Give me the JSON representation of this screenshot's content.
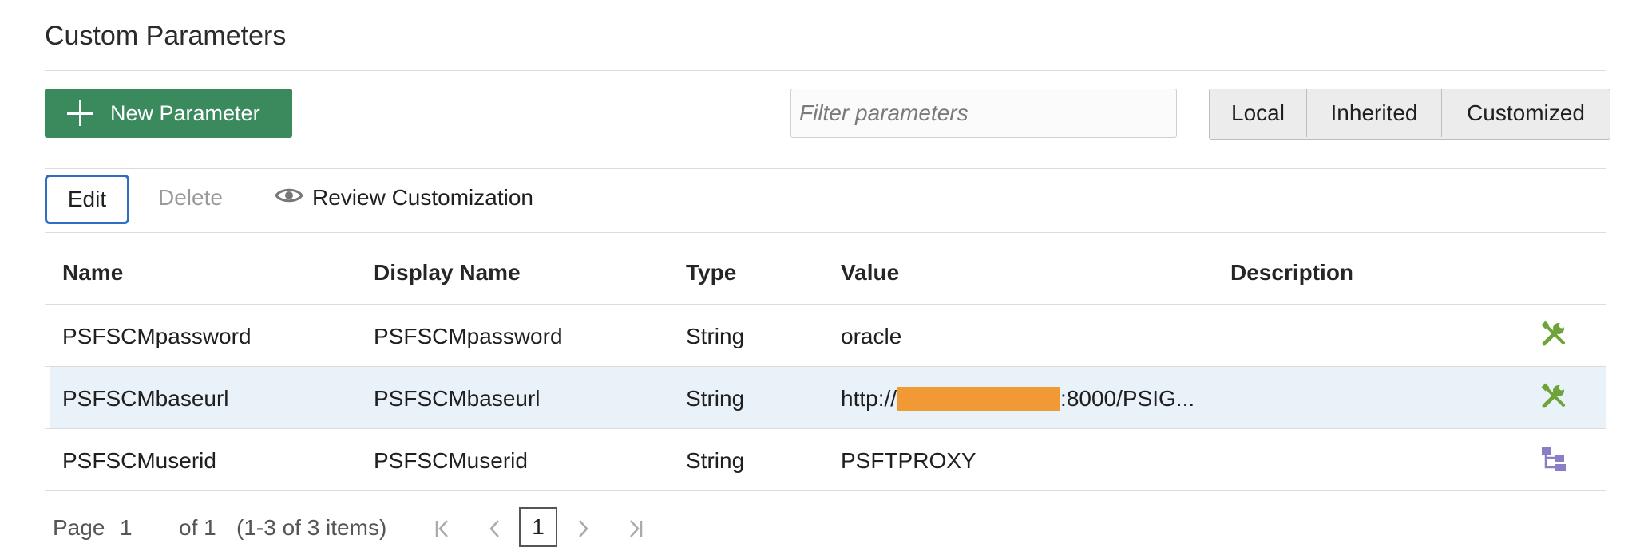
{
  "page": {
    "title": "Custom Parameters"
  },
  "toolbar": {
    "new_label": "New Parameter",
    "filter_placeholder": "Filter parameters",
    "segments": [
      "Local",
      "Inherited",
      "Customized"
    ],
    "edit_label": "Edit",
    "delete_label": "Delete",
    "review_label": "Review Customization"
  },
  "table": {
    "headers": [
      "Name",
      "Display Name",
      "Type",
      "Value",
      "Description"
    ],
    "rows": [
      {
        "name": "PSFSCMpassword",
        "display_name": "PSFSCMpassword",
        "type": "String",
        "value": "oracle",
        "description": "",
        "icon": "wrench-screwdriver-icon"
      },
      {
        "name": "PSFSCMbaseurl",
        "display_name": "PSFSCMbaseurl",
        "type": "String",
        "value_prefix": "http://",
        "value_suffix": ":8000/PSIG...",
        "description": "",
        "icon": "wrench-screwdriver-icon",
        "selected": true
      },
      {
        "name": "PSFSCMuserid",
        "display_name": "PSFSCMuserid",
        "type": "String",
        "value": "PSFTPROXY",
        "description": "",
        "icon": "hierarchy-icon"
      }
    ]
  },
  "pagination": {
    "page_label": "Page",
    "page_value": "1",
    "of_label": "of 1",
    "items_label": "(1-3 of 3 items)",
    "current_page": "1"
  },
  "colors": {
    "primary_button": "#3b8a5e",
    "focus_border": "#2e6ec5",
    "selected_row": "#e9f1f9",
    "redaction": "#f19a35",
    "wrench_icon": "#6ea33a",
    "hierarchy_icon": "#8a7fc4"
  }
}
